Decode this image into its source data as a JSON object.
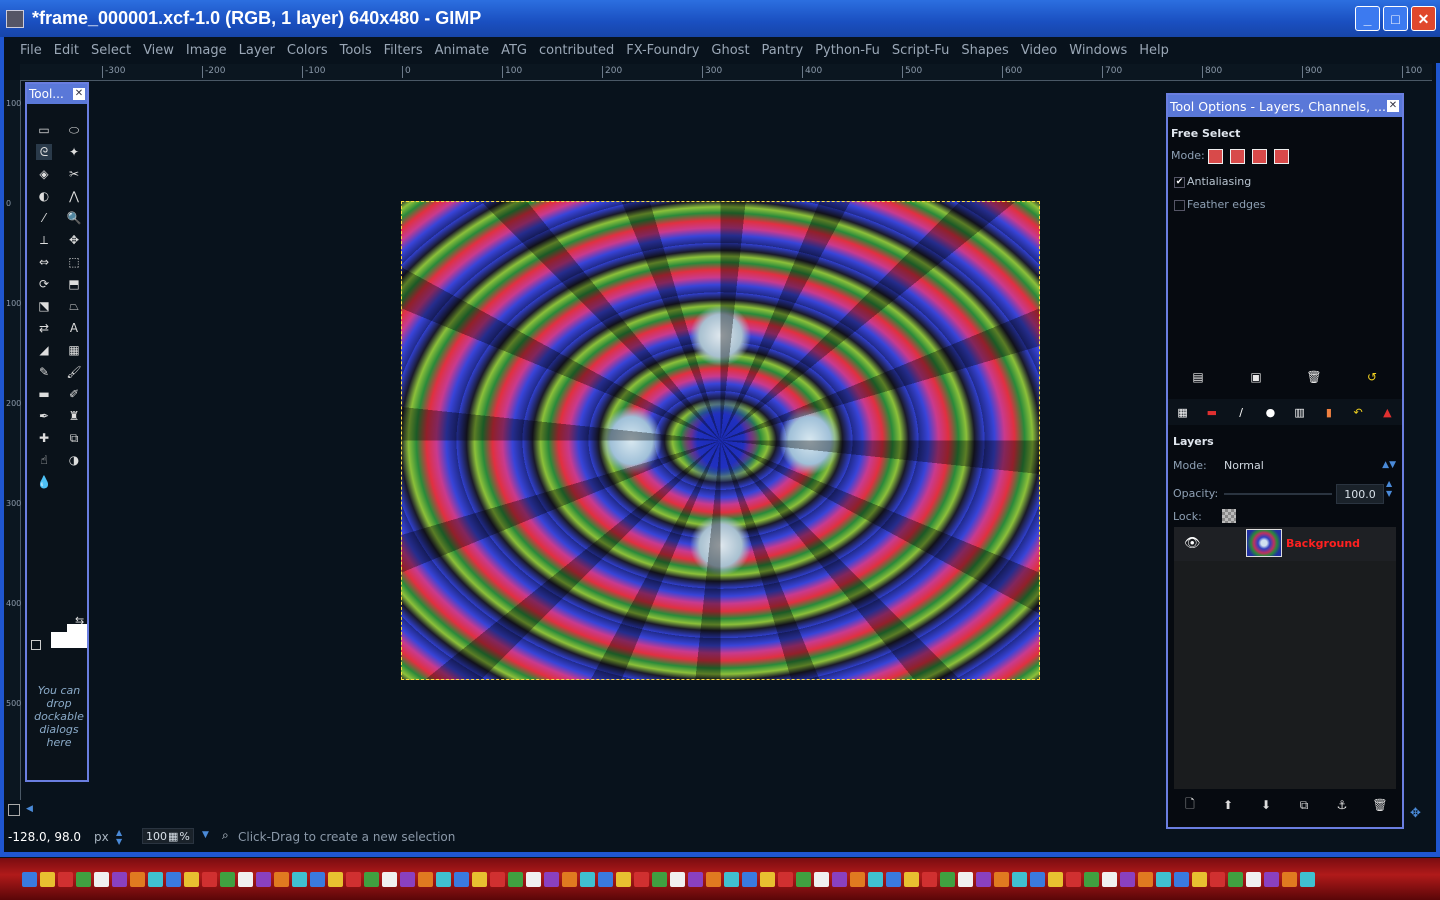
{
  "window": {
    "title": "*frame_000001.xcf-1.0 (RGB, 1 layer) 640x480 - GIMP",
    "minimize": "_",
    "maximize": "□",
    "close": "✕"
  },
  "menu": [
    "File",
    "Edit",
    "Select",
    "View",
    "Image",
    "Layer",
    "Colors",
    "Tools",
    "Filters",
    "Animate",
    "ATG",
    "contributed",
    "FX-Foundry",
    "Ghost",
    "Pantry",
    "Python-Fu",
    "Script-Fu",
    "Shapes",
    "Video",
    "Windows",
    "Help"
  ],
  "ruler": {
    "h_ticks": [
      "-300",
      "-200",
      "-100",
      "0",
      "100",
      "200",
      "300",
      "400",
      "500",
      "600",
      "700",
      "800",
      "900",
      "100"
    ],
    "v_ticks": [
      "100",
      "0",
      "100",
      "200",
      "300",
      "400",
      "500"
    ]
  },
  "toolbox": {
    "title": "Tool...",
    "close": "✕",
    "drop_hint": "You can drop dockable dialogs here",
    "tools": [
      "rect-select-icon",
      "ellipse-select-icon",
      "free-select-icon",
      "fuzzy-select-icon",
      "select-by-color-icon",
      "scissors-icon",
      "foreground-select-icon",
      "paths-icon",
      "color-picker-icon",
      "zoom-icon",
      "measure-icon",
      "move-icon",
      "align-icon",
      "crop-icon",
      "rotate-icon",
      "scale-icon",
      "shear-icon",
      "perspective-icon",
      "flip-icon",
      "text-icon",
      "bucket-fill-icon",
      "blend-icon",
      "pencil-icon",
      "paintbrush-icon",
      "eraser-icon",
      "airbrush-icon",
      "ink-icon",
      "clone-icon",
      "heal-icon",
      "perspective-clone-icon",
      "smudge-icon",
      "dodge-burn-icon",
      "blur-icon"
    ]
  },
  "tool_options": {
    "dock_title": "Tool Options - Layers, Channels, ...",
    "close": "✕",
    "tool_name": "Free Select",
    "mode_label": "Mode:",
    "antialiasing": "Antialiasing",
    "feather": "Feather edges"
  },
  "layers": {
    "section": "Layers",
    "mode_label": "Mode:",
    "mode_value": "Normal",
    "opacity_label": "Opacity:",
    "opacity_value": "100.0",
    "lock_label": "Lock:",
    "items": [
      {
        "name": "Background",
        "visible": true
      }
    ]
  },
  "status": {
    "coords": "-128.0, 98.0",
    "unit": "px",
    "zoom": "100",
    "zoom_suffix": "%",
    "message": "Click-Drag to create a new selection"
  },
  "colors": {
    "title_bar": "#1f56d0",
    "dock_header": "#5a78d8",
    "layer_name": "#ff2020",
    "selection": "#ffe040"
  }
}
